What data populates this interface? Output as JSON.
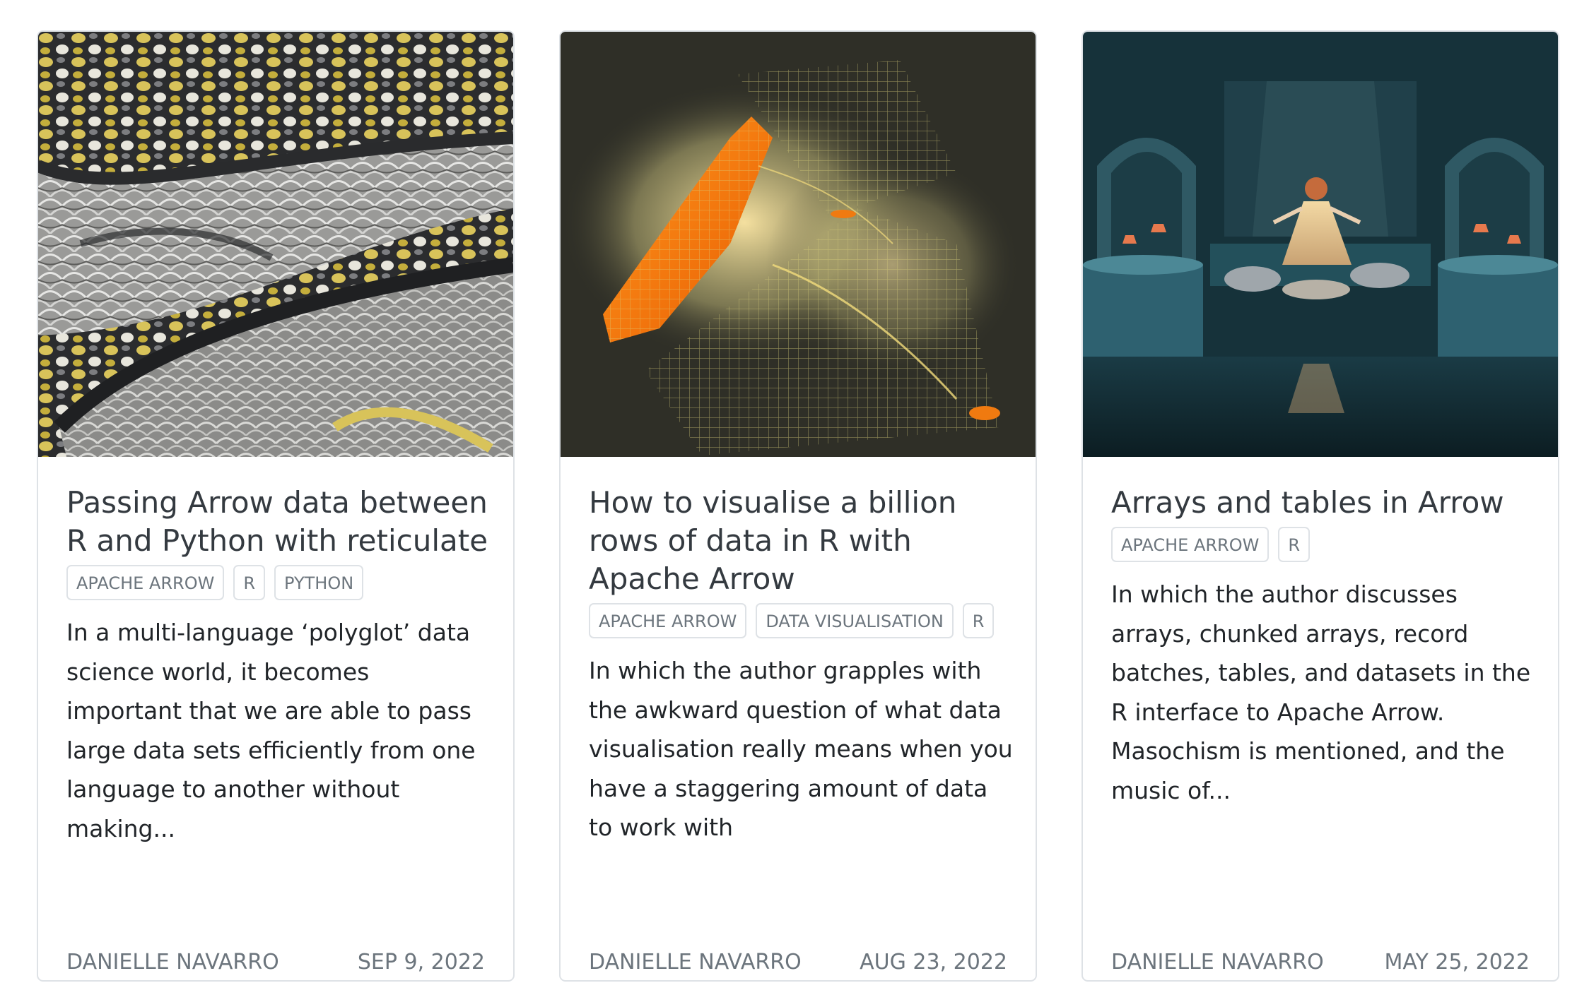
{
  "cards": [
    {
      "image": "python-snake-scales-photo",
      "title": "Passing Arrow data between R and Python with reticulate",
      "tags": [
        "APACHE ARROW",
        "R",
        "PYTHON"
      ],
      "description": "In a multi-language ‘polyglot’ data science world, it becomes important that we are able to pass large data sets efficiently from one language to another without making...",
      "author": "DANIELLE NAVARRO",
      "date": "SEP 9, 2022"
    },
    {
      "image": "nyc-taxi-pickups-glowing-map",
      "title": "How to visualise a billion rows of data in R with Apache Arrow",
      "tags": [
        "APACHE ARROW",
        "DATA VISUALISATION",
        "R"
      ],
      "description": "In which the author grapples with the awkward question of what data visualisation really means when you have a staggering amount of data to work with",
      "author": "DANIELLE NAVARRO",
      "date": "AUG 23, 2022"
    },
    {
      "image": "teal-theatre-stage-performers-photo",
      "title": "Arrays and tables in Arrow",
      "tags": [
        "APACHE ARROW",
        "R"
      ],
      "description": "In which the author discusses arrays, chunked arrays, record batches, tables, and datasets in the R interface to Apache Arrow. Masochism is mentioned, and the music of...",
      "author": "DANIELLE NAVARRO",
      "date": "MAY 25, 2022"
    }
  ]
}
